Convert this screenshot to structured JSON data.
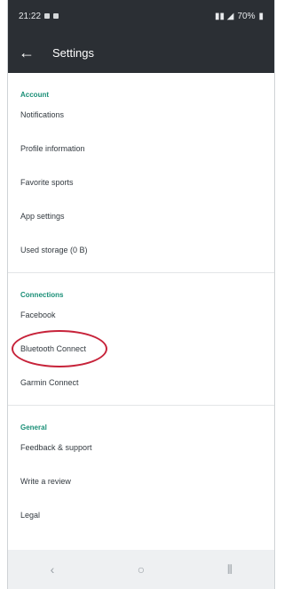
{
  "status_bar": {
    "time": "21:22",
    "battery": "70%"
  },
  "app_bar": {
    "title": "Settings"
  },
  "sections": [
    {
      "header": "Account",
      "items": [
        "Notifications",
        "Profile information",
        "Favorite sports",
        "App settings",
        "Used storage (0 B)"
      ]
    },
    {
      "header": "Connections",
      "items": [
        "Facebook",
        "Bluetooth Connect",
        "Garmin Connect"
      ]
    },
    {
      "header": "General",
      "items": [
        "Feedback & support",
        "Write a review",
        "Legal"
      ]
    }
  ],
  "annotation": {
    "highlighted_item": "Bluetooth Connect",
    "color": "#c7233a"
  },
  "icons": {
    "back": "arrow-left-icon",
    "nav": [
      "recent-apps-icon",
      "home-icon",
      "back-nav-icon"
    ]
  },
  "colors": {
    "toolbar": "#2b2f34",
    "section_header": "#1a8f77"
  }
}
